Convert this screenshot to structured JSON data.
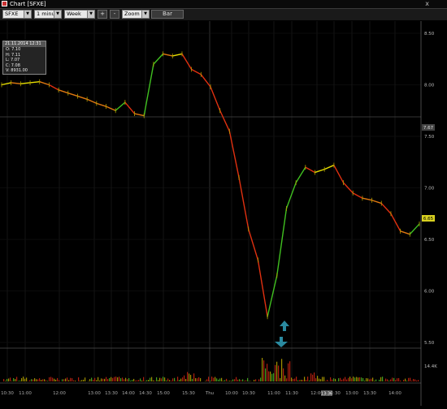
{
  "window": {
    "title": "Chart [SFXE]",
    "close_glyph": "x"
  },
  "toolbar": {
    "symbol": "SFXE",
    "interval": "1 minute",
    "range": "Week",
    "plus_label": "+",
    "minus_label": "-",
    "mode": "Zoom",
    "style_label": "Bar"
  },
  "info_box": {
    "header": "21.11.2014 12:31",
    "open": "O: 7.10",
    "high": "H: 7.11",
    "low": "L: 7.07",
    "close": "C: 7.08",
    "volume": "V: 8931.00"
  },
  "price_axis": {
    "ticks": [
      "8.50",
      "8.00",
      "7.50",
      "7.00",
      "6.50",
      "6.00",
      "5.50"
    ],
    "ref_label": "7.67",
    "last_label": "6.65"
  },
  "volume_axis": {
    "label": "14.4K"
  },
  "time_axis": {
    "labels": [
      "10:30",
      "11:00",
      "12:00",
      "13:00",
      "13:30",
      "14:00",
      "14:30",
      "15:00",
      "15:30",
      "Thu",
      "10:00",
      "10:30",
      "11:00",
      "11:30",
      "12:00",
      "12:30",
      "13:00",
      "13:30",
      "14:00"
    ],
    "highlight": "13:36"
  },
  "chart_data": {
    "type": "line",
    "symbol": "SFXE",
    "interval": "1 minute",
    "ylim": [
      5.4,
      8.6
    ],
    "series": [
      {
        "values": [
          8.0,
          8.02,
          8.01,
          8.02,
          8.03,
          8.0,
          7.95,
          7.92,
          7.89,
          7.86,
          7.82,
          7.79,
          7.75,
          7.83,
          7.72,
          7.7,
          8.2,
          8.3,
          8.28,
          8.3,
          8.15,
          8.1,
          7.98,
          7.75,
          7.55,
          7.1,
          6.6,
          6.3,
          5.75,
          6.15,
          6.8,
          7.05,
          7.2,
          7.15,
          7.18,
          7.22,
          7.05,
          6.95,
          6.9,
          6.88,
          6.85,
          6.75,
          6.58,
          6.55,
          6.65
        ]
      }
    ]
  }
}
